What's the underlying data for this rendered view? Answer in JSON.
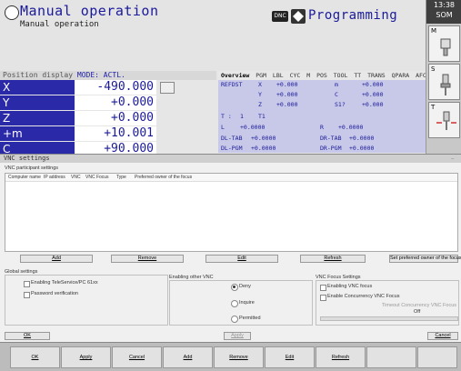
{
  "header": {
    "mode_title": "Manual operation",
    "mode_subtitle": "Manual operation",
    "dnc_badge": "DNC",
    "prog_title": "Programming"
  },
  "sidebar": {
    "clock": "13:38",
    "clock_sub": "SOM",
    "buttons": [
      "M",
      "S",
      "T"
    ]
  },
  "position": {
    "title_prefix": "Position display",
    "mode": "MODE: ACTL.",
    "rows": [
      {
        "axis": "X",
        "value": "-490.000"
      },
      {
        "axis": "Y",
        "value": "+0.000"
      },
      {
        "axis": "Z",
        "value": "+0.000"
      },
      {
        "axis": "+m",
        "value": "+10.001"
      },
      {
        "axis": "C",
        "value": "+90.000"
      }
    ]
  },
  "overview": {
    "tabs": [
      "Overview",
      "PGM",
      "LBL",
      "CYC",
      "M",
      "POS",
      "TOOL",
      "TT",
      "TRANS",
      "QPARA",
      "AFC"
    ],
    "refdst": "REFDST",
    "rows": [
      [
        "X",
        "+0.000",
        "m",
        "+0.000"
      ],
      [
        "Y",
        "+0.000",
        "C",
        "+0.000"
      ],
      [
        "Z",
        "+0.000",
        "S1?",
        "+0.000"
      ]
    ],
    "t_label": "T :",
    "t_num": "1",
    "t_name": "T1",
    "l_label": "L",
    "l_val": "+0.0000",
    "r_label": "R",
    "r_val": "+0.0000",
    "dltab": "DL-TAB",
    "dltab_val": "+0.0000",
    "drtab": "DR-TAB",
    "drtab_val": "+0.0000",
    "dlpgm": "DL-PGM",
    "dlpgm_val": "+0.0000",
    "drpgm": "DR-PGM",
    "drpgm_val": "+0.0000"
  },
  "vnc": {
    "title": "VNC settings",
    "close": "– ×",
    "participants_label": "VNC participant settings",
    "columns": [
      "Computer name",
      "IP address",
      "VNC",
      "VNC Focus",
      "Type",
      "Preferred owner of the focus"
    ],
    "buttons": {
      "add": "Add",
      "remove": "Remove",
      "edit": "Edit",
      "refresh": "Refresh",
      "set_preferred": "Set preferred owner of the focus",
      "ok": "OK",
      "apply": "Apply",
      "cancel": "Cancel"
    },
    "global_label": "Global settings",
    "global_checks": [
      "Enabling TeleService/PC 61xx",
      "Password verification"
    ],
    "other_label": "Enabling other VNC",
    "radios": [
      "Deny",
      "Inquire",
      "Permitted"
    ],
    "selected_radio": "Deny",
    "focus_label": "VNC Focus Settings",
    "focus_checks": [
      "Enabling VNC focus",
      "Enable Concurrency VNC Focus"
    ],
    "timeout_label": "Timeout Concurrency VNC Focus",
    "timeout_value": "Off"
  },
  "softkeys": [
    "OK",
    "Apply",
    "Cancel",
    "Add",
    "Remove",
    "Edit",
    "Refresh",
    "",
    ""
  ],
  "colors": {
    "accent_blue": "#2a2aa8",
    "title_blue": "#1a1a9a",
    "overview_bg": "#c8c8e8"
  }
}
